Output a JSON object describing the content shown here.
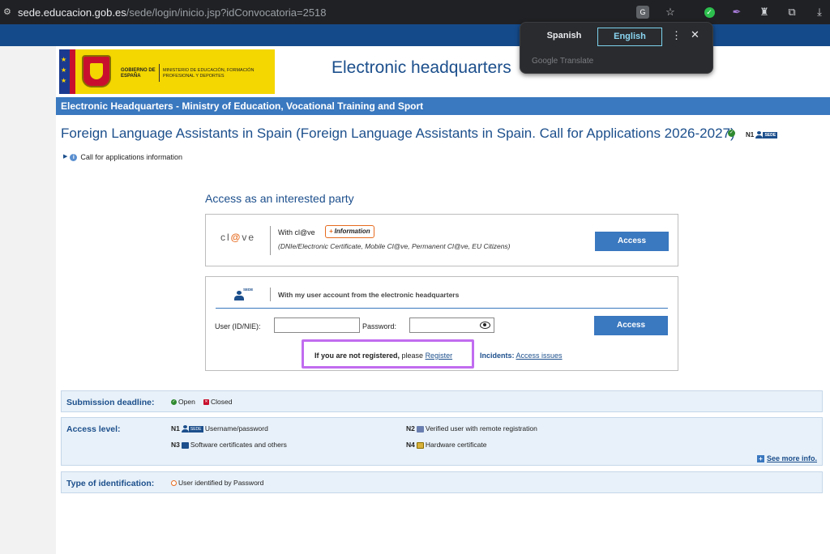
{
  "browser": {
    "url_host": "sede.educacion.gob.es",
    "url_path": "/sede/login/inicio.jsp?idConvocatoria=2518"
  },
  "translate_popup": {
    "source_lang": "Spanish",
    "target_lang": "English",
    "footer": "Google Translate"
  },
  "header": {
    "logo_gobierno": "GOBIERNO DE ESPAÑA",
    "logo_ministerio": "MINISTERIO DE EDUCACIÓN, FORMACIÓN PROFESIONAL Y DEPORTES",
    "site_title": "Electronic headquarters",
    "breadcrumb": "Electronic Headquarters - Ministry of Education, Vocational Training and Sport"
  },
  "page": {
    "title": "Foreign Language Assistants in Spain (Foreign Language Assistants in Spain. Call for Applications 2026-2027)",
    "level_badge": "N1",
    "sede_badge": "SEDE",
    "call_info": "Call for applications information"
  },
  "access": {
    "title": "Access as an interested party",
    "clave": {
      "logo_text_pre": "cl",
      "logo_text_at": "@",
      "logo_text_post": "ve",
      "with_label": "With cl@ve",
      "info_label": "Information",
      "description": "(DNIe/Electronic Certificate, Mobile Cl@ve, Permanent Cl@ve, EU Citizens)",
      "button": "Access"
    },
    "user_account": {
      "sede_icon_label": "SEDE",
      "title": "With my user account from the electronic headquarters",
      "user_label": "User (ID/NIE):",
      "user_value": "",
      "password_label": "Password:",
      "password_value": "",
      "button": "Access",
      "not_registered": "If you are not registered,",
      "please": " please ",
      "register_link": "Register",
      "incidents_label": "Incidents:",
      "incidents_link": "Access issues"
    }
  },
  "info_panels": {
    "submission": {
      "label": "Submission deadline:",
      "open": "Open",
      "closed": "Closed"
    },
    "access_level": {
      "label": "Access level:",
      "n1": "N1",
      "n1_badge": "SEDE",
      "n1_text": "Username/password",
      "n2": "N2",
      "n2_text": "Verified user with remote registration",
      "n3": "N3",
      "n3_text": "Software certificates and others",
      "n4": "N4",
      "n4_text": "Hardware certificate",
      "see_more": "See more info."
    },
    "identification": {
      "label": "Type of identification:",
      "value": "User identified by Password"
    }
  },
  "colors": {
    "brand_blue": "#1c4f8c",
    "accent_blue": "#3a78bf",
    "highlight": "#c16cf0",
    "clave_orange": "#e66a1e"
  }
}
